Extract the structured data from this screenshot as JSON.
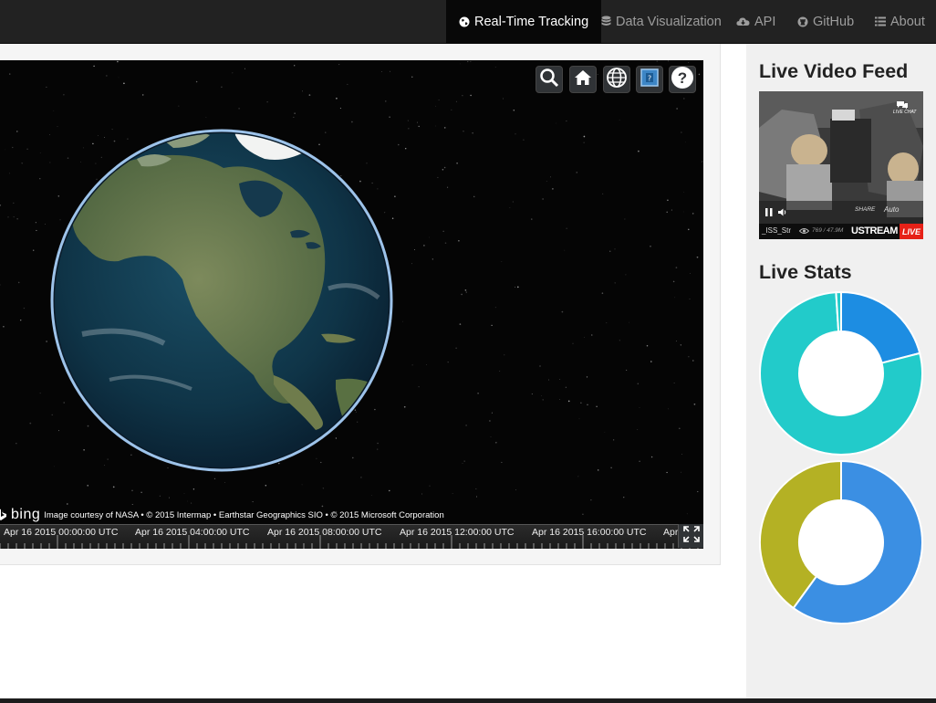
{
  "nav": {
    "items": [
      {
        "label": "Real-Time Tracking",
        "icon": "globe-icon",
        "active": true
      },
      {
        "label": "Data Visualization",
        "icon": "database-icon",
        "active": false
      },
      {
        "label": "API",
        "icon": "cloud-download-icon",
        "active": false
      },
      {
        "label": "GitHub",
        "icon": "github-icon",
        "active": false
      },
      {
        "label": "About",
        "icon": "list-icon",
        "active": false
      }
    ]
  },
  "viewer": {
    "toolbar": [
      "search-icon",
      "home-icon",
      "globe-icon",
      "scene-mode-icon",
      "help-icon"
    ],
    "help_glyph": "?",
    "credit": {
      "logo": "bing",
      "text": "Image courtesy of NASA • © 2015 Intermap • Earthstar Geographics SIO • © 2015 Microsoft Corporation"
    },
    "timeline_labels": [
      "Apr 16 2015 00:00:00 UTC",
      "Apr 16 2015 04:00:00 UTC",
      "Apr 16 2015 08:00:00 UTC",
      "Apr 16 2015 12:00:00 UTC",
      "Apr 16 2015 16:00:00 UTC",
      "Apr"
    ]
  },
  "sidebar": {
    "video_title": "Live Video Feed",
    "video": {
      "channel": "_ISS_Str",
      "viewers": "769 / 47.9M",
      "brand": "USTREAM",
      "live": "LIVE",
      "share": "SHARE",
      "quality": "Auto",
      "chat": "LIVE CHAT"
    },
    "stats_title": "Live Stats"
  },
  "colors": {
    "navbar": "#222222",
    "nav_active": "#080808",
    "teal": "#22cbca",
    "blue": "#1d8de2",
    "olive": "#b4b124",
    "sky": "#3b8fe3"
  },
  "chart_data": [
    {
      "type": "donut",
      "slices": [
        {
          "value": 21,
          "color": "#1d8de2"
        },
        {
          "value": 78,
          "color": "#22cbca"
        },
        {
          "value": 1,
          "color": "#22cbca"
        }
      ]
    },
    {
      "type": "donut",
      "slices": [
        {
          "value": 60,
          "color": "#3b8fe3"
        },
        {
          "value": 40,
          "color": "#b4b124"
        }
      ]
    }
  ]
}
